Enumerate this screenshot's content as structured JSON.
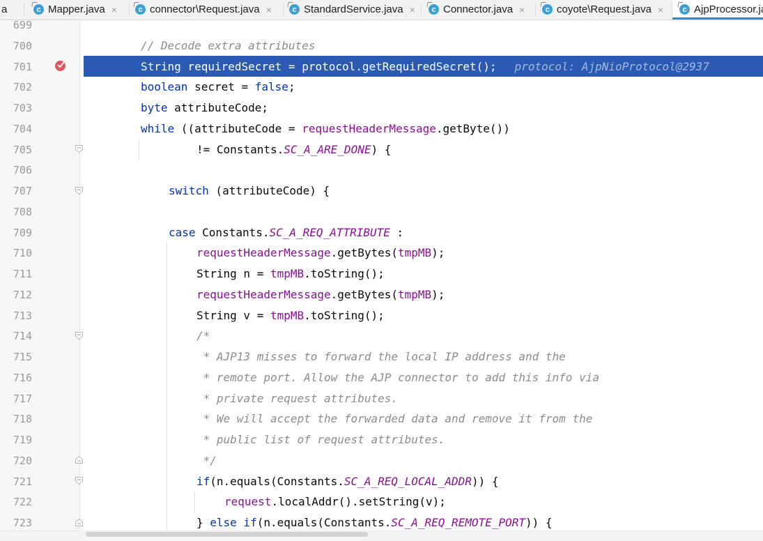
{
  "tabs": [
    {
      "label": "a",
      "closable": false,
      "partial": true
    },
    {
      "label": "Mapper.java",
      "icon": "java-class-icon",
      "closable": true
    },
    {
      "label": "connector\\Request.java",
      "icon": "java-class-icon",
      "closable": true
    },
    {
      "label": "StandardService.java",
      "icon": "java-class-icon",
      "closable": true
    },
    {
      "label": "Connector.java",
      "icon": "java-class-icon",
      "closable": true
    },
    {
      "label": "coyote\\Request.java",
      "icon": "java-class-icon",
      "closable": true
    },
    {
      "label": "AjpProcessor.ja",
      "icon": "java-class-icon",
      "active": true,
      "partial": true
    }
  ],
  "tab_close_glyph": "×",
  "editor": {
    "colors": {
      "keyword": "#0033b3",
      "field": "#871094",
      "comment": "#8c8c8c",
      "exec_line_bg": "#2a5ab3",
      "breakpoint": "#db5860"
    },
    "breakpoint_line": "701",
    "current_line": "701",
    "inline_hint": "protocol: AjpNioProtocol@2937",
    "lines": [
      {
        "n": "699",
        "tokens": []
      },
      {
        "n": "700",
        "tokens": [
          {
            "t": "// Decode extra attributes",
            "c": "cmt"
          }
        ]
      },
      {
        "n": "701",
        "tokens": [
          {
            "t": "String requiredSecret = protocol.getRequiredSecret();",
            "c": ""
          }
        ]
      },
      {
        "n": "702",
        "tokens": [
          {
            "t": "boolean",
            "c": "kw"
          },
          {
            "t": " secret = ",
            "c": ""
          },
          {
            "t": "false",
            "c": "kw"
          },
          {
            "t": ";",
            "c": ""
          }
        ]
      },
      {
        "n": "703",
        "tokens": [
          {
            "t": "byte",
            "c": "kw"
          },
          {
            "t": " attributeCode;",
            "c": ""
          }
        ]
      },
      {
        "n": "704",
        "tokens": [
          {
            "t": "while",
            "c": "kw"
          },
          {
            "t": " ((attributeCode = ",
            "c": ""
          },
          {
            "t": "requestHeaderMessage",
            "c": "fld"
          },
          {
            "t": ".getByte())",
            "c": ""
          }
        ]
      },
      {
        "n": "705",
        "tokens": [
          {
            "t": "!= Constants.",
            "c": ""
          },
          {
            "t": "SC_A_ARE_DONE",
            "c": "cnst"
          },
          {
            "t": ") {",
            "c": ""
          }
        ]
      },
      {
        "n": "706",
        "tokens": []
      },
      {
        "n": "707",
        "tokens": [
          {
            "t": "switch",
            "c": "kw"
          },
          {
            "t": " (attributeCode) {",
            "c": ""
          }
        ]
      },
      {
        "n": "708",
        "tokens": []
      },
      {
        "n": "709",
        "tokens": [
          {
            "t": "case",
            "c": "kw"
          },
          {
            "t": " Constants.",
            "c": ""
          },
          {
            "t": "SC_A_REQ_ATTRIBUTE",
            "c": "cnst"
          },
          {
            "t": " :",
            "c": ""
          }
        ]
      },
      {
        "n": "710",
        "tokens": [
          {
            "t": "requestHeaderMessage",
            "c": "fld"
          },
          {
            "t": ".getBytes(",
            "c": ""
          },
          {
            "t": "tmpMB",
            "c": "fld"
          },
          {
            "t": ");",
            "c": ""
          }
        ]
      },
      {
        "n": "711",
        "tokens": [
          {
            "t": "String n = ",
            "c": ""
          },
          {
            "t": "tmpMB",
            "c": "fld"
          },
          {
            "t": ".toString();",
            "c": ""
          }
        ]
      },
      {
        "n": "712",
        "tokens": [
          {
            "t": "requestHeaderMessage",
            "c": "fld"
          },
          {
            "t": ".getBytes(",
            "c": ""
          },
          {
            "t": "tmpMB",
            "c": "fld"
          },
          {
            "t": ");",
            "c": ""
          }
        ]
      },
      {
        "n": "713",
        "tokens": [
          {
            "t": "String v = ",
            "c": ""
          },
          {
            "t": "tmpMB",
            "c": "fld"
          },
          {
            "t": ".toString();",
            "c": ""
          }
        ]
      },
      {
        "n": "714",
        "tokens": [
          {
            "t": "/*",
            "c": "cmt"
          }
        ]
      },
      {
        "n": "715",
        "tokens": [
          {
            "t": " * AJP13 misses to forward the local IP address and the",
            "c": "cmt"
          }
        ]
      },
      {
        "n": "716",
        "tokens": [
          {
            "t": " * remote port. Allow the AJP connector to add this info via",
            "c": "cmt"
          }
        ]
      },
      {
        "n": "717",
        "tokens": [
          {
            "t": " * private request attributes.",
            "c": "cmt"
          }
        ]
      },
      {
        "n": "718",
        "tokens": [
          {
            "t": " * We will accept the forwarded data and remove it from the",
            "c": "cmt"
          }
        ]
      },
      {
        "n": "719",
        "tokens": [
          {
            "t": " * public list of request attributes.",
            "c": "cmt"
          }
        ]
      },
      {
        "n": "720",
        "tokens": [
          {
            "t": " */",
            "c": "cmt"
          }
        ]
      },
      {
        "n": "721",
        "tokens": [
          {
            "t": "if",
            "c": "kw"
          },
          {
            "t": "(n.equals(Constants.",
            "c": ""
          },
          {
            "t": "SC_A_REQ_LOCAL_ADDR",
            "c": "cnst"
          },
          {
            "t": ")) {",
            "c": ""
          }
        ]
      },
      {
        "n": "722",
        "tokens": [
          {
            "t": "request",
            "c": "fld"
          },
          {
            "t": ".localAddr().setString(v);",
            "c": ""
          }
        ]
      },
      {
        "n": "723",
        "tokens": [
          {
            "t": "} ",
            "c": ""
          },
          {
            "t": "else if",
            "c": "kw"
          },
          {
            "t": "(n.equals(Constants.",
            "c": ""
          },
          {
            "t": "SC_A_REQ_REMOTE_PORT",
            "c": "cnst"
          },
          {
            "t": ")) {",
            "c": ""
          }
        ]
      }
    ]
  }
}
